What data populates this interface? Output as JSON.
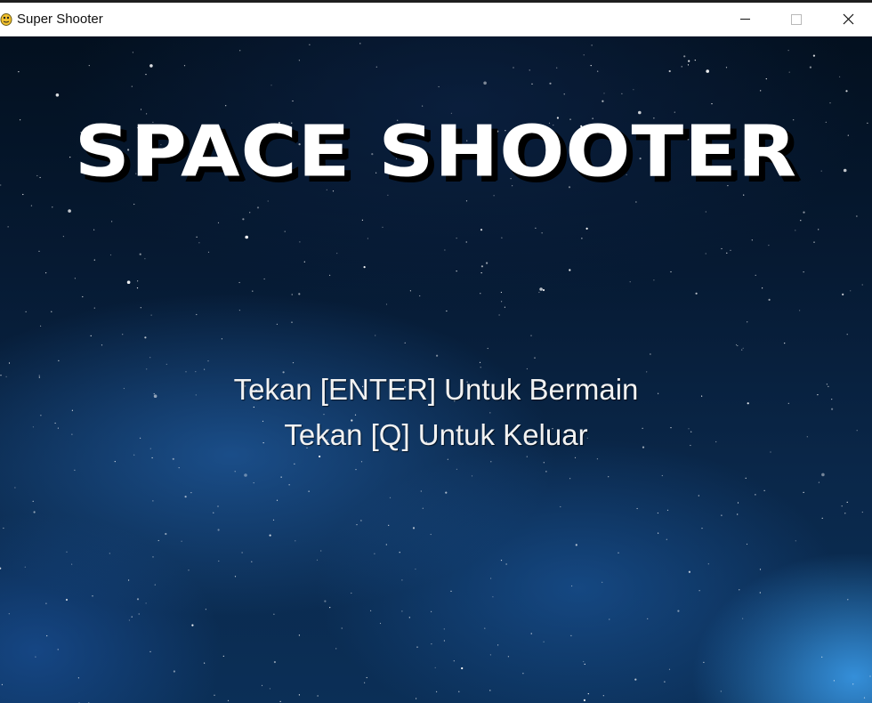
{
  "window": {
    "title": "Super Shooter",
    "minimize_label": "Minimize",
    "maximize_label": "Maximize",
    "close_label": "Close",
    "app_icon": "pygame-snake-icon"
  },
  "game": {
    "title": "SPACE SHOOTER",
    "menu": {
      "start_prompt": "Tekan [ENTER] Untuk Bermain",
      "quit_prompt": "Tekan [Q] Untuk Keluar"
    },
    "colors": {
      "background_top": "#03101f",
      "background_bottom": "#0b2f57",
      "title_text": "#ffffff",
      "title_shadow": "#000000",
      "menu_text": "#f2f2f2"
    }
  }
}
